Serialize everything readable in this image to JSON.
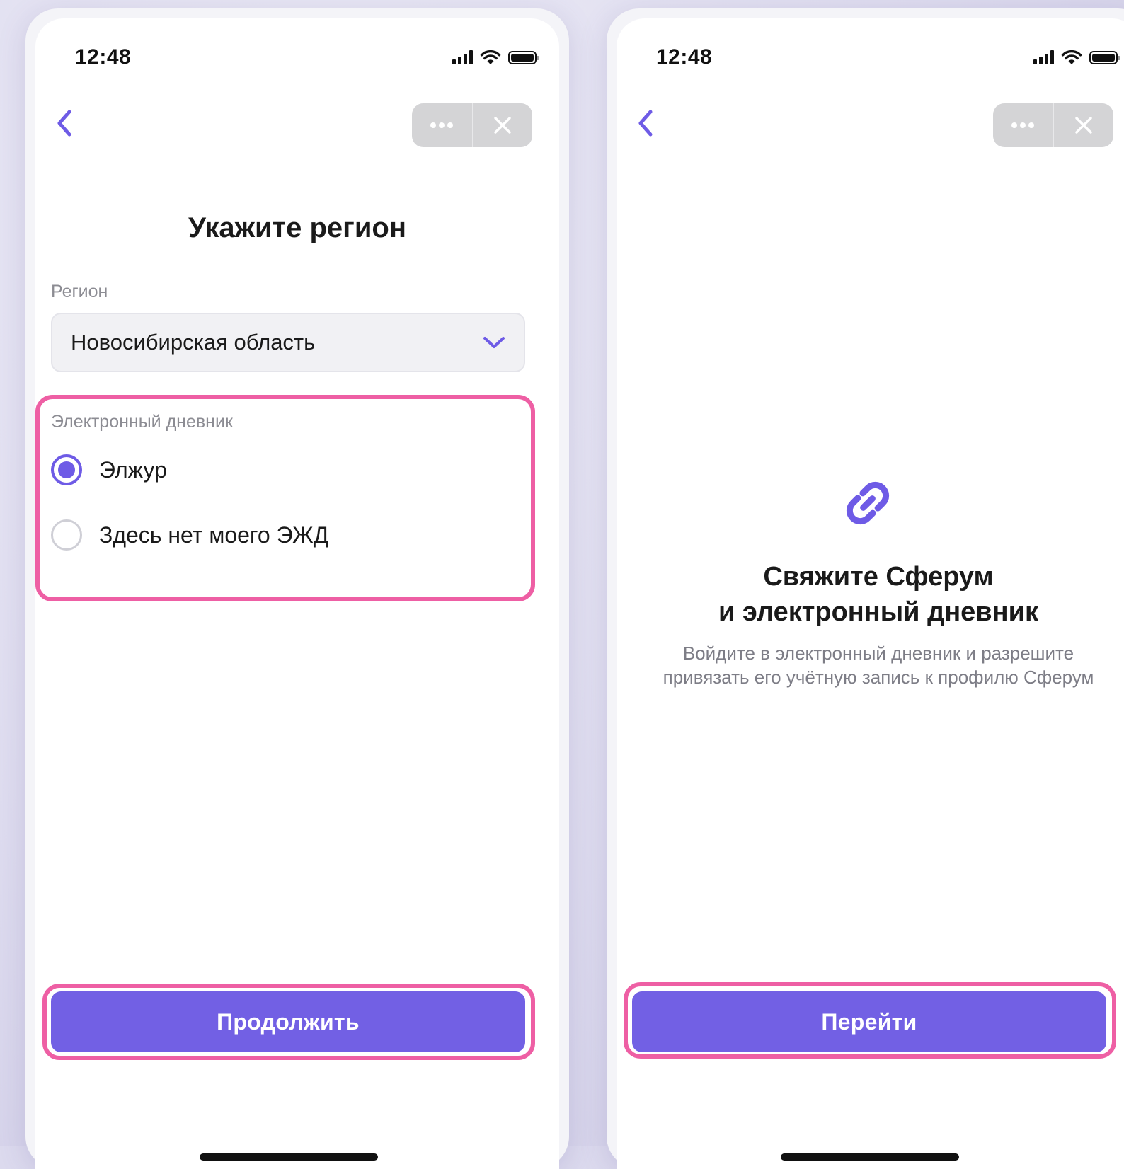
{
  "colors": {
    "accent": "#7260e4",
    "highlight": "#ee5fa4",
    "capsule": "#d4d4d6"
  },
  "left_screen": {
    "status": {
      "time": "12:48"
    },
    "nav": {
      "back_icon": "chevron-left-icon",
      "more_icon": "more-horizontal-icon",
      "close_icon": "close-icon"
    },
    "title": "Укажите регион",
    "region": {
      "label": "Регион",
      "value": "Новосибирская область"
    },
    "diary": {
      "label": "Электронный дневник",
      "options": [
        {
          "label": "Элжур",
          "selected": true
        },
        {
          "label": "Здесь нет моего ЭЖД",
          "selected": false
        }
      ]
    },
    "button": {
      "label": "Продолжить"
    }
  },
  "right_screen": {
    "status": {
      "time": "12:48"
    },
    "nav": {
      "back_icon": "chevron-left-icon",
      "more_icon": "more-horizontal-icon",
      "close_icon": "close-icon"
    },
    "icon": "link-icon",
    "title_line1": "Свяжите Сферум",
    "title_line2": "и электронный дневник",
    "subtitle_line1": "Войдите в электронный дневник и разрешите",
    "subtitle_line2": "привязать его учётную запись к профилю Сферум",
    "button": {
      "label": "Перейти"
    }
  }
}
